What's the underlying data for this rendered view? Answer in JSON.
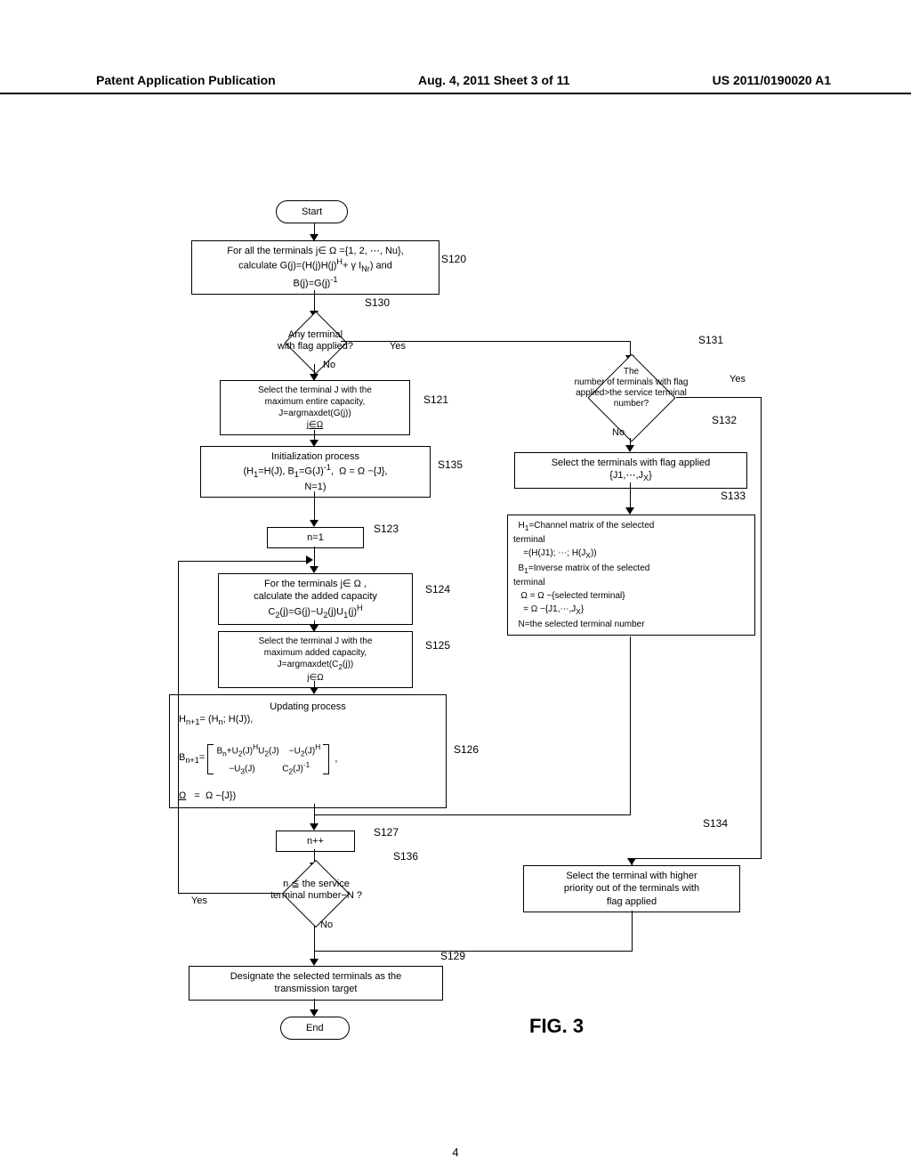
{
  "header": {
    "left": "Patent Application Publication",
    "center": "Aug. 4, 2011  Sheet 3 of 11",
    "right": "US 2011/0190020 A1"
  },
  "figure_label": "FIG. 3",
  "page_number": "4",
  "steps": {
    "s120": "S120",
    "s121": "S121",
    "s123": "S123",
    "s124": "S124",
    "s125": "S125",
    "s126": "S126",
    "s127": "S127",
    "s129": "S129",
    "s130": "S130",
    "s131": "S131",
    "s132": "S132",
    "s133": "S133",
    "s134": "S134",
    "s135": "S135",
    "s136": "S136"
  },
  "nodes": {
    "start": "Start",
    "end": "End",
    "calc_init": "For all the terminals j∈ Ω ={1, 2, ⋯, Nu},\ncalculate G(j)=(H(j)H(j)ᴴ+ γ I_Nr) and\nB(j)=G(j)⁻¹",
    "any_flag": "Any terminal\nwith flag applied?",
    "select_max": "Select the terminal J with the\nmaximum entire capacity,\nJ=argmaxdet(G(j))\nj∈Ω",
    "init_process": "Initialization process\n(H₁=H(J), B₁=G(J)⁻¹,  Ω = Ω −{J},\nN=1)",
    "n1": "n=1",
    "calc_added": "For the terminals j∈ Ω ,\ncalculate the added capacity\nC₂(j)=G(j)−U₂(j)U₁(j)ᴴ",
    "select_added": "Select the terminal J with the\nmaximum added capacity,\nJ=argmaxdet(C₂(j))\nj∈Ω",
    "updating": "Updating process\nH_{n+1}= (Hₙ; H(J)),\n\nB_{n+1}=  Bₙ+U₂(J)ᴴU₂(J)    −U₂(J)ᴴ\n              −U₃(J)              C₂(J)⁻¹   ,\n\nΩ   =  Ω −{J})",
    "npp": "n++",
    "n_leq": "n ≦ the service\nterminal number−N ?",
    "designate": "Designate the selected terminals as the\ntransmission target",
    "flag_count": "The\nnumber of terminals with flag\napplied>the service terminal\nnumber?",
    "select_flag": "Select the terminals with flag applied\n{J1,⋯,Jx}",
    "channel_matrix": "H₁=Channel matrix of the selected terminal\n  =(H(J1); ⋯; H(Jx))\nB₁=Inverse matrix of the selected terminal\n  Ω = Ω −{selected terminal}\n  = Ω −{J1,⋯,Jx}\nN=the selected terminal number",
    "select_priority": "Select the terminal with higher\npriority out of the terminals with\nflag applied"
  },
  "labels": {
    "yes": "Yes",
    "no": "No"
  }
}
